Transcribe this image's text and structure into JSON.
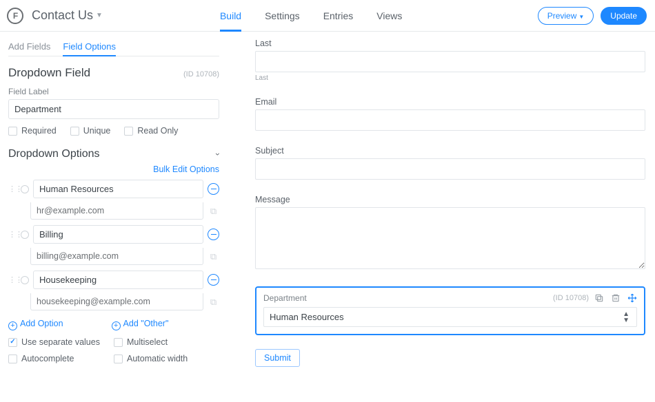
{
  "header": {
    "form_title": "Contact Us",
    "tabs": [
      "Build",
      "Settings",
      "Entries",
      "Views"
    ],
    "active_tab": "Build",
    "preview_label": "Preview",
    "update_label": "Update"
  },
  "sidebar": {
    "subtabs": [
      "Add Fields",
      "Field Options"
    ],
    "active_subtab": "Field Options",
    "field_type": "Dropdown Field",
    "field_id": "(ID 10708)",
    "field_label_caption": "Field Label",
    "field_label_value": "Department",
    "checks_top": [
      {
        "label": "Required",
        "checked": false
      },
      {
        "label": "Unique",
        "checked": false
      },
      {
        "label": "Read Only",
        "checked": false
      }
    ],
    "options_heading": "Dropdown Options",
    "bulk_edit": "Bulk Edit Options",
    "options": [
      {
        "label": "Human Resources",
        "value": "hr@example.com"
      },
      {
        "label": "Billing",
        "value": "billing@example.com"
      },
      {
        "label": "Housekeeping",
        "value": "housekeeping@example.com"
      }
    ],
    "add_option": "Add Option",
    "add_other": "Add \"Other\"",
    "checks_bottom": [
      {
        "label": "Use separate values",
        "checked": true
      },
      {
        "label": "Multiselect",
        "checked": false
      },
      {
        "label": "Autocomplete",
        "checked": false
      },
      {
        "label": "Automatic width",
        "checked": false
      }
    ]
  },
  "canvas": {
    "fields": [
      {
        "label": "Last",
        "sublabel": "Last",
        "type": "text"
      },
      {
        "label": "Email",
        "type": "text"
      },
      {
        "label": "Subject",
        "type": "text"
      },
      {
        "label": "Message",
        "type": "textarea"
      }
    ],
    "selected": {
      "label": "Department",
      "id": "(ID 10708)",
      "value": "Human Resources"
    },
    "submit": "Submit"
  }
}
